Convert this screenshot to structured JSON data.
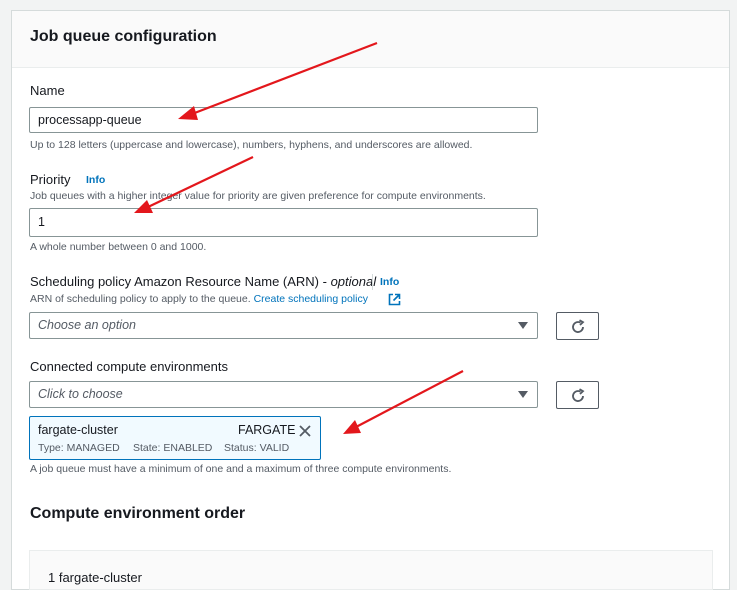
{
  "page": {
    "title": "Job queue configuration",
    "section2_title": "Compute environment order"
  },
  "name": {
    "label": "Name",
    "value": "processapp-queue",
    "hint": "Up to 128 letters (uppercase and lowercase), numbers, hyphens, and underscores are allowed."
  },
  "priority": {
    "label": "Priority",
    "info": "Info",
    "description": "Job queues with a higher integer value for priority are given preference for compute environments.",
    "value": "1",
    "hint": "A whole number between 0 and 1000."
  },
  "scheduling": {
    "label": "Scheduling policy Amazon Resource Name (ARN) - ",
    "optional": "optional",
    "info": "Info",
    "description": "ARN of scheduling policy to apply to the queue. ",
    "link": "Create scheduling policy",
    "placeholder": "Choose an option"
  },
  "compute": {
    "label": "Connected compute environments",
    "placeholder": "Click to choose",
    "token": {
      "name": "fargate-cluster",
      "kind": "FARGATE",
      "type": "Type: MANAGED",
      "state": "State: ENABLED",
      "status": "Status: VALID"
    },
    "hint": "A job queue must have a minimum of one and a maximum of three compute environments."
  },
  "order": {
    "first_item_partial": "1   fargate-cluster"
  },
  "colors": {
    "accent": "#0073bb",
    "annotation_arrow": "#e3171c"
  },
  "icons": [
    "refresh-icon",
    "caret-down-icon",
    "close-icon",
    "external-link-icon"
  ]
}
